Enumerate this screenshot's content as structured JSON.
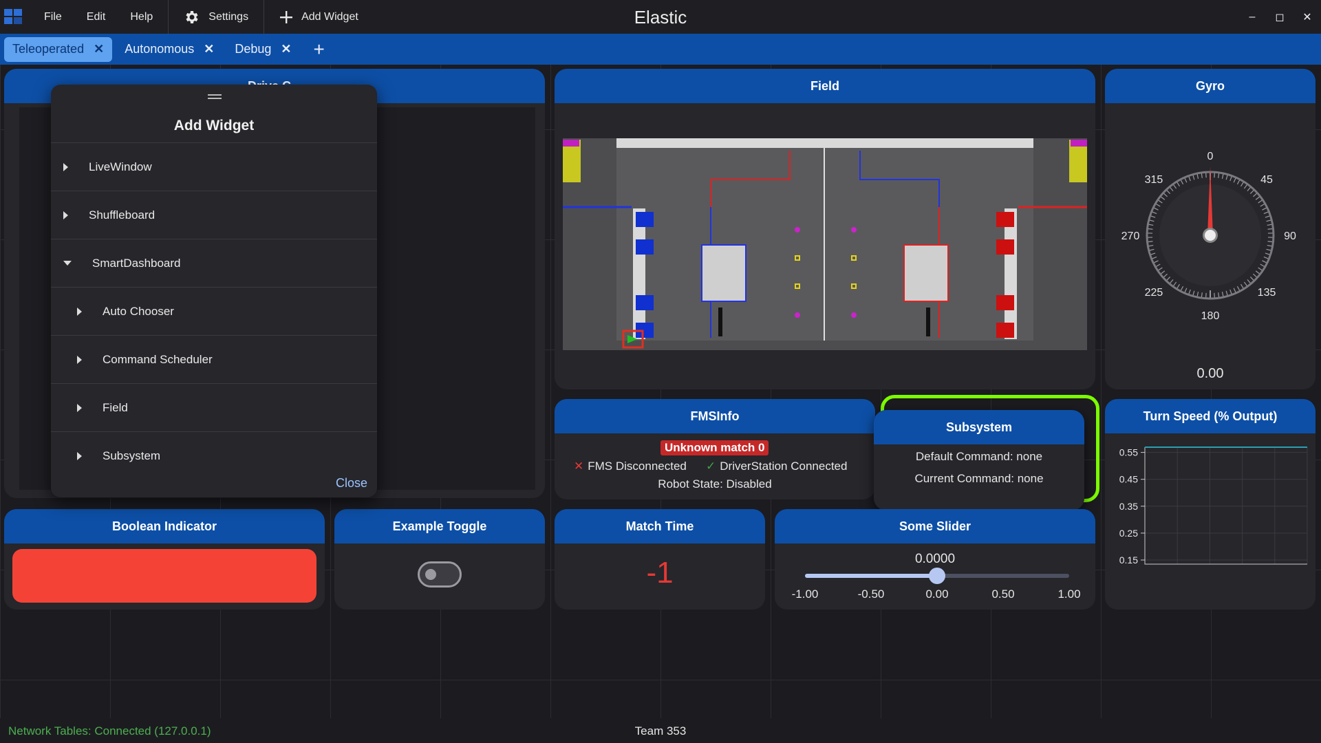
{
  "window": {
    "title": "Elastic"
  },
  "menu": {
    "file": "File",
    "edit": "Edit",
    "help": "Help"
  },
  "toolbar": {
    "settings": "Settings",
    "add_widget": "Add Widget"
  },
  "window_controls": {
    "minimize": "–",
    "maximize": "◻",
    "close": "✕"
  },
  "tabs": [
    {
      "label": "Teleoperated",
      "active": true
    },
    {
      "label": "Autonomous",
      "active": false
    },
    {
      "label": "Debug",
      "active": false
    }
  ],
  "widgets": {
    "drive": {
      "title": "Drive C..."
    },
    "field": {
      "title": "Field"
    },
    "gyro": {
      "title": "Gyro",
      "value": "0.00",
      "labels": [
        "0",
        "45",
        "90",
        "135",
        "180",
        "225",
        "270",
        "315"
      ],
      "heading_deg": 0
    },
    "fms": {
      "title": "FMSInfo",
      "match": "Unknown match 0",
      "fms_status": "FMS Disconnected",
      "ds_status": "DriverStation Connected",
      "robot_state": "Robot State: Disabled"
    },
    "subsystem": {
      "title": "Subsystem",
      "default_cmd": "Default Command: none",
      "current_cmd": "Current Command: none"
    },
    "turn_speed": {
      "title": "Turn Speed (% Output)"
    },
    "boolean": {
      "title": "Boolean Indicator",
      "color": "#f44336"
    },
    "toggle": {
      "title": "Example Toggle"
    },
    "match_time": {
      "title": "Match Time",
      "value": "-1"
    },
    "slider": {
      "title": "Some Slider",
      "value": "0.0000",
      "position": 0.5,
      "ticks": [
        "-1.00",
        "-0.50",
        "0.00",
        "0.50",
        "1.00"
      ]
    }
  },
  "chart_data": {
    "type": "line",
    "title": "Turn Speed (% Output)",
    "y_ticks": [
      "0.55",
      "0.45",
      "0.35",
      "0.25",
      "0.15"
    ],
    "ylim": [
      0.15,
      0.55
    ],
    "series": [
      {
        "values": [
          0.6,
          0.6
        ]
      }
    ],
    "grid": true
  },
  "dialog": {
    "title": "Add Widget",
    "items": [
      {
        "label": "LiveWindow",
        "expanded": false,
        "level": 0
      },
      {
        "label": "Shuffleboard",
        "expanded": false,
        "level": 0
      },
      {
        "label": "SmartDashboard",
        "expanded": true,
        "level": 0
      },
      {
        "label": "Auto Chooser",
        "expanded": false,
        "level": 1
      },
      {
        "label": "Command Scheduler",
        "expanded": false,
        "level": 1
      },
      {
        "label": "Field",
        "expanded": false,
        "level": 1
      },
      {
        "label": "Subsystem",
        "expanded": false,
        "level": 1
      }
    ],
    "close": "Close"
  },
  "status": {
    "network": "Network Tables: Connected (127.0.0.1)",
    "team": "Team 353"
  },
  "colors": {
    "accent": "#0d4fa6",
    "tab_active": "#5ea2f0",
    "status_ok": "#4caf50",
    "highlight": "#7cfc00",
    "alert": "#f44336"
  }
}
